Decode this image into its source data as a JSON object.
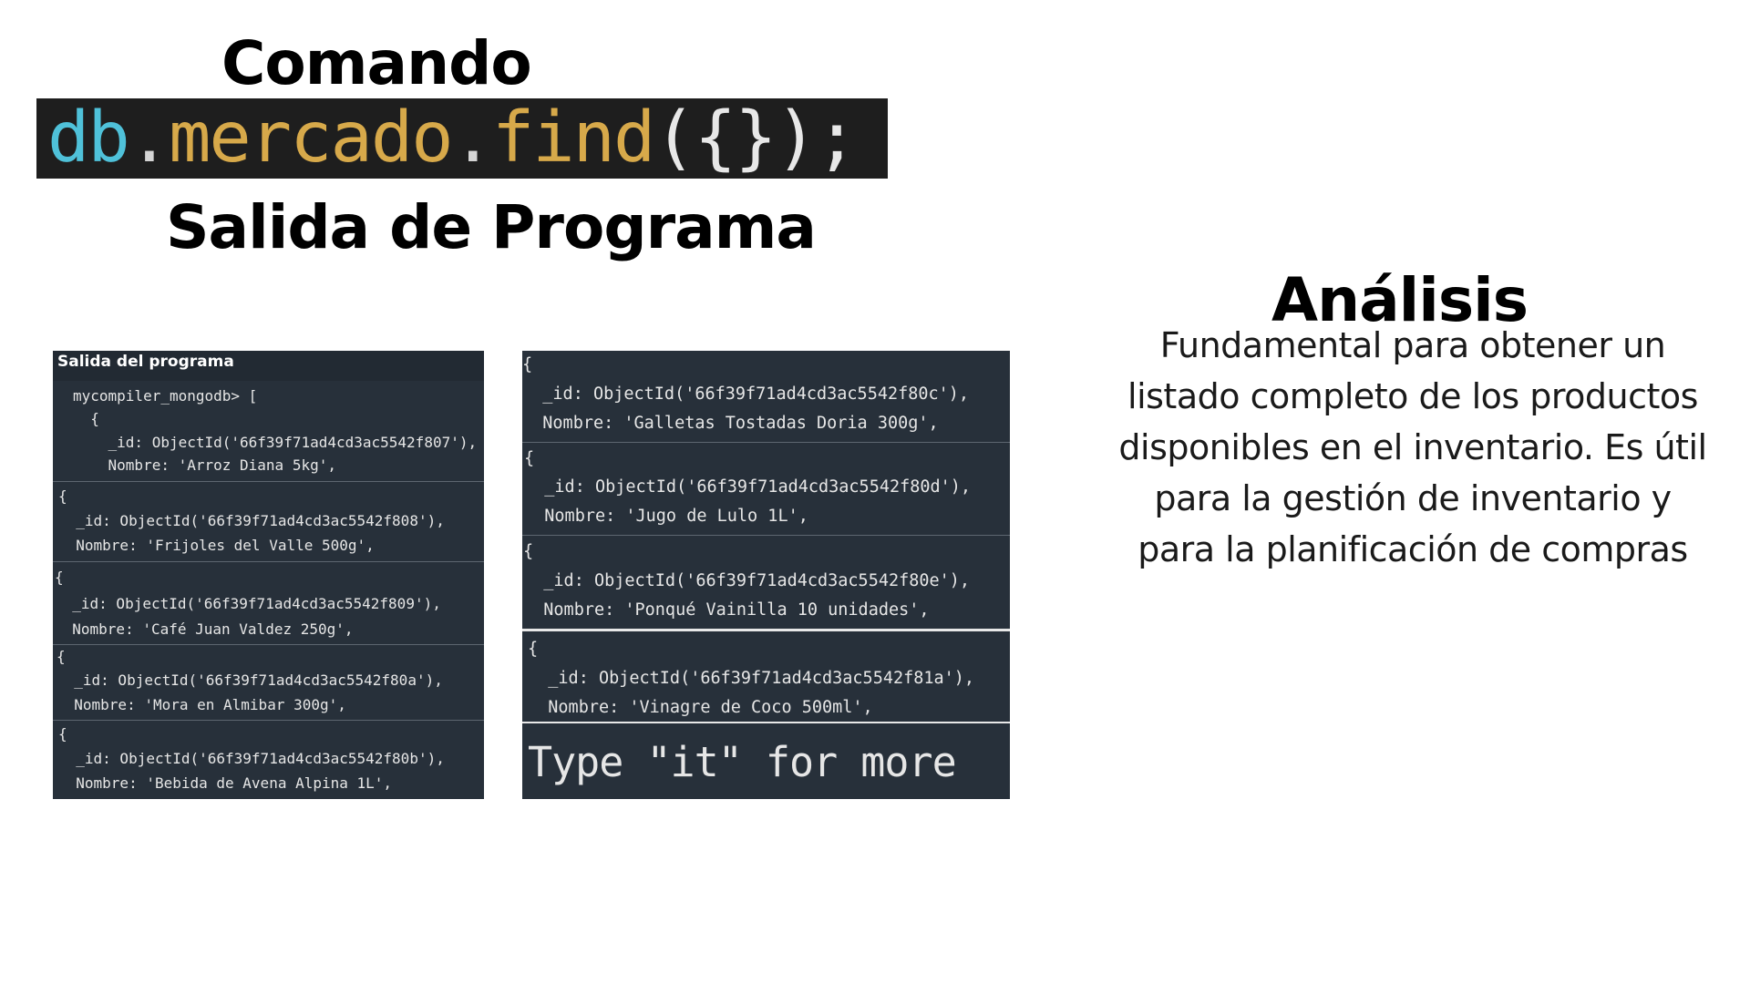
{
  "headings": {
    "comando": "Comando",
    "salida": "Salida de Programa",
    "analisis": "Análisis"
  },
  "command": {
    "object": "db",
    "dot1": ".",
    "collection": "mercado",
    "dot2": ".",
    "method": "find",
    "args": "({});"
  },
  "left_panel": {
    "header": "Salida del programa",
    "segments": [
      {
        "lines": [
          "mycompiler_mongodb> [",
          "  {",
          "    _id: ObjectId('66f39f71ad4cd3ac5542f807'),",
          "    Nombre: 'Arroz Diana 5kg',"
        ]
      },
      {
        "lines": [
          "{",
          "  _id: ObjectId('66f39f71ad4cd3ac5542f808'),",
          "  Nombre: 'Frijoles del Valle 500g',"
        ]
      },
      {
        "lines": [
          "{",
          "  _id: ObjectId('66f39f71ad4cd3ac5542f809'),",
          "  Nombre: 'Café Juan Valdez 250g',"
        ]
      },
      {
        "lines": [
          "{",
          "  _id: ObjectId('66f39f71ad4cd3ac5542f80a'),",
          "  Nombre: 'Mora en Almibar 300g',"
        ]
      },
      {
        "lines": [
          "{",
          "  _id: ObjectId('66f39f71ad4cd3ac5542f80b'),",
          "  Nombre: 'Bebida de Avena Alpina 1L',"
        ]
      }
    ]
  },
  "right_panel": {
    "segments": [
      {
        "lines": [
          "{",
          "  _id: ObjectId('66f39f71ad4cd3ac5542f80c'),",
          "  Nombre: 'Galletas Tostadas Doria 300g',"
        ]
      },
      {
        "lines": [
          "{",
          "  _id: ObjectId('66f39f71ad4cd3ac5542f80d'),",
          "  Nombre: 'Jugo de Lulo 1L',"
        ]
      },
      {
        "lines": [
          "{",
          "  _id: ObjectId('66f39f71ad4cd3ac5542f80e'),",
          "  Nombre: 'Ponqué Vainilla 10 unidades',"
        ]
      },
      {
        "lines": [
          "{",
          "  _id: ObjectId('66f39f71ad4cd3ac5542f81a'),",
          "  Nombre: 'Vinagre de Coco 500ml',"
        ]
      }
    ],
    "more_prompt": "Type \"it\" for more"
  },
  "analysis": {
    "lines": [
      "Fundamental para obtener un",
      "listado completo de los productos",
      "disponibles en el inventario. Es útil",
      "para la gestión de inventario y",
      "para la planificación de compras"
    ]
  },
  "colors": {
    "terminal_bg": "#27303a",
    "command_bg": "#1e1e1e",
    "command_object": "#4fc1d9",
    "command_method": "#d7a94a"
  }
}
